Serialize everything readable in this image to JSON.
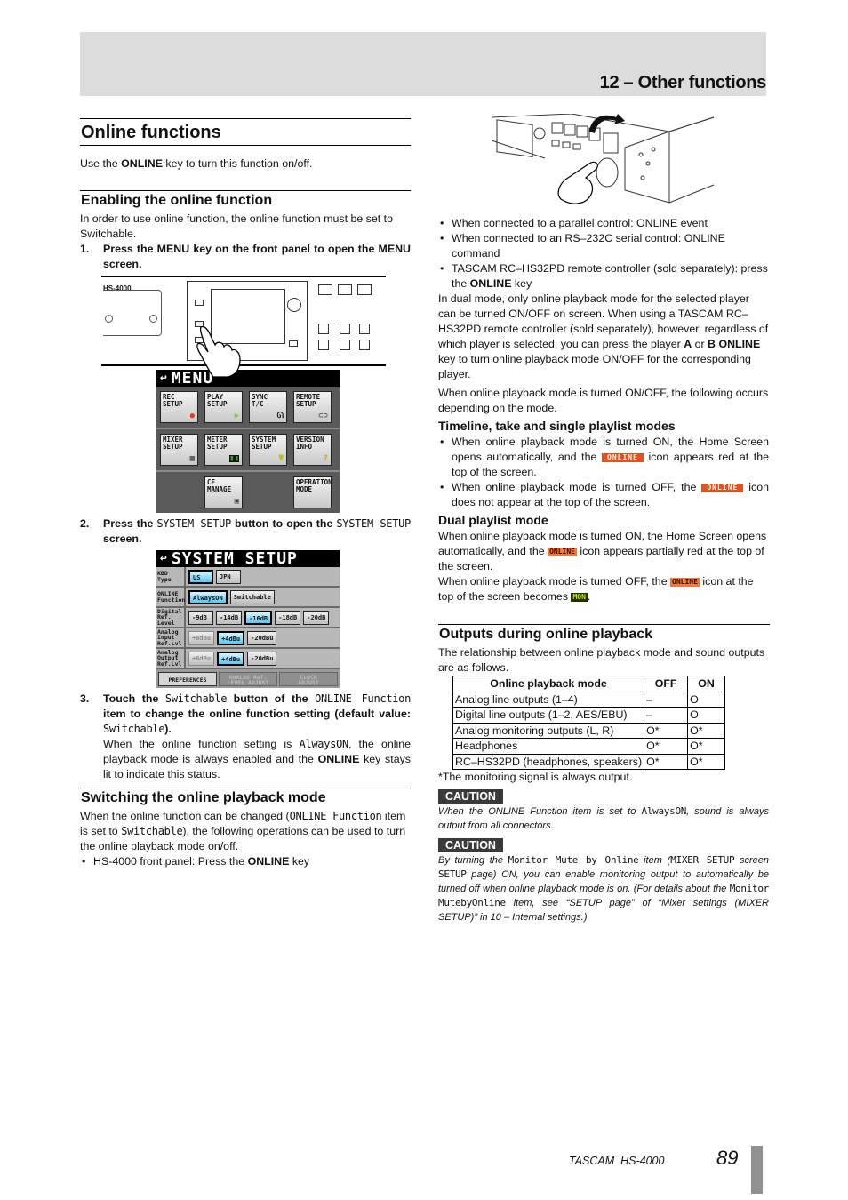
{
  "header": {
    "chapter": "12 – Other functions"
  },
  "left": {
    "title": "Online functions",
    "intro_pre": "Use the ",
    "intro_key": "ONLINE",
    "intro_post": " key to turn this function on/off.",
    "enabling": {
      "heading": "Enabling the online function",
      "body": "In order to use online function, the online function must be set to Switchable.",
      "step1_num": "1.",
      "step1": "Press the MENU key on the front panel to open the MENU screen.",
      "panel_model": "HS-4000",
      "menu_screen": {
        "title": "MENU",
        "rows": [
          [
            {
              "label": "REC\nSETUP",
              "icon": "record-dot-icon",
              "glyph": "●",
              "color": "#e2401a"
            },
            {
              "label": "PLAY\nSETUP",
              "icon": "play-arrow-icon",
              "glyph": "▶",
              "color": "#7ac943"
            },
            {
              "label": "SYNC\nT/C",
              "icon": "waveform-icon",
              "glyph": "⩍",
              "color": "#222222"
            },
            {
              "label": "REMOTE\nSETUP",
              "icon": "remote-connector-icon",
              "glyph": "⊂⊃",
              "color": "#555555"
            }
          ],
          [
            {
              "label": "MIXER\nSETUP",
              "icon": "mixer-grid-icon",
              "glyph": "▦",
              "color": "#444444"
            },
            {
              "label": "METER\nSETUP",
              "icon": "level-meter-icon",
              "glyph": "▮",
              "color": "#3aa020"
            },
            {
              "label": "SYSTEM\nSETUP",
              "icon": "wrench-icon",
              "glyph": "Ψ",
              "color": "#c8b400"
            },
            {
              "label": "VERSION\nINFO",
              "icon": "question-mark-icon",
              "glyph": "?",
              "color": "#c8a800"
            }
          ],
          [
            {
              "label": "CF\nMANAGE",
              "icon": "cf-card-icon",
              "glyph": "▣",
              "color": "#444444"
            },
            {
              "label": "OPERATION\nMODE",
              "icon": "",
              "glyph": "",
              "color": ""
            }
          ]
        ]
      },
      "step2_num": "2.",
      "step2_a": "Press the ",
      "step2_b": "SYSTEM SETUP",
      "step2_c": " button to open the ",
      "step2_d": "SYSTEM SETUP",
      "step2_e": " screen.",
      "system_screen": {
        "title": "SYSTEM SETUP",
        "rows": [
          {
            "label": "KBD\nType",
            "options": [
              "US",
              "JPN"
            ],
            "selected": 0,
            "disabled": []
          },
          {
            "label": "ONLINE\nFunction",
            "options": [
              "AlwaysON",
              "Switchable"
            ],
            "selected": 0,
            "disabled": []
          },
          {
            "label": "Digital\nRef.\nLevel",
            "options": [
              "-9dB",
              "-14dB",
              "-16dB",
              "-18dB",
              "-20dB"
            ],
            "selected": 2,
            "disabled": []
          },
          {
            "label": "Analog\nInput\nRef.Lvl",
            "options": [
              "+6dBu",
              "+4dBu",
              "-20dBu"
            ],
            "selected": 1,
            "disabled": [
              0
            ]
          },
          {
            "label": "Analog\nOutput\nRef.Lvl",
            "options": [
              "+6dBu",
              "+4dBu",
              "-20dBu"
            ],
            "selected": 1,
            "disabled": [
              0
            ]
          }
        ],
        "tabs": [
          {
            "label": "PREFERENCES",
            "active": true
          },
          {
            "label": "ANALOG Ref.\nLEVEL ADJUST",
            "active": false
          },
          {
            "label": "CLOCK\nADJUST",
            "active": false
          }
        ]
      },
      "step3_num": "3.",
      "step3_a": "Touch the ",
      "step3_b": "Switchable",
      "step3_c": " button of the ",
      "step3_d": "ONLINE Function",
      "step3_e": " item to change the online function setting (default value: ",
      "step3_f": "Switchable",
      "step3_g": ").",
      "step3_note_a": "When the online function setting is ",
      "step3_note_b": "AlwaysON",
      "step3_note_c": ", the online playback mode is always enabled and the ",
      "step3_note_d": "ONLINE",
      "step3_note_e": " key stays lit to indicate this status."
    },
    "switching": {
      "heading": "Switching the online playback mode",
      "body_a": "When the online function can be changed (",
      "body_b": "ONLINE Function",
      "body_c": " item is set to ",
      "body_d": "Switchable",
      "body_e": "), the following operations can be used to turn the online playback mode on/off.",
      "bullet1_a": "HS-4000 front panel: Press the ",
      "bullet1_b": "ONLINE",
      "bullet1_c": " key"
    }
  },
  "right": {
    "bullets": [
      "When connected to a parallel control: ONLINE event",
      "When connected to an RS–232C serial control: ONLINE command"
    ],
    "bullet3_a": "TASCAM RC–HS32PD remote controller (sold separately): press the ",
    "bullet3_b": "ONLINE",
    "bullet3_c": " key",
    "dual_a": "In dual mode, only online playback mode for the selected player can be turned ON/OFF on screen. When using a TASCAM RC–HS32PD remote controller (sold separately), however, regardless of which player is selected, you can press the player ",
    "dual_b": "A",
    "dual_c": " or ",
    "dual_d": "B ONLINE",
    "dual_e": " key to turn online playback mode ON/OFF for the corresponding player.",
    "onoff": "When online playback mode is turned ON/OFF, the following occurs depending on the mode.",
    "timeline": {
      "heading": "Timeline, take and single playlist modes",
      "b1_a": "When online playback mode is turned ON, the Home Screen opens automatically, and the ",
      "b1_b": " icon appears red at the top of the screen.",
      "b2_a": "When online playback mode is turned OFF, the ",
      "b2_b": " icon does not appear at the top of the screen."
    },
    "dual": {
      "heading": "Dual playlist mode",
      "p1_a": "When online playback mode is turned ON, the Home Screen opens automatically, and the ",
      "p1_b": " icon appears partially red at the top of the screen.",
      "p2_a": "When online playback mode is turned OFF, the ",
      "p2_b": " icon at the top of the screen becomes ",
      "p2_c": "."
    },
    "icons": {
      "online": "ONLINE",
      "online_small": "ONLINE",
      "mon": "MON"
    },
    "outputs": {
      "heading": "Outputs during online playback",
      "body": "The relationship between online playback mode and sound outputs are as follows.",
      "table": {
        "headers": [
          "Online playback mode",
          "OFF",
          "ON"
        ],
        "rows": [
          [
            "Analog line outputs (1–4)",
            "–",
            "O"
          ],
          [
            "Digital line outputs (1–2, AES/EBU)",
            "–",
            "O"
          ],
          [
            "Analog monitoring outputs (L, R)",
            "O*",
            "O*"
          ],
          [
            "Headphones",
            "O*",
            "O*"
          ],
          [
            "RC–HS32PD (headphones, speakers)",
            "O*",
            "O*"
          ]
        ]
      },
      "footnote": "*The monitoring signal is always output."
    },
    "caution1": {
      "label": "CAUTION",
      "a": "When the ONLINE Function item is set to ",
      "b": "AlwaysON",
      "c": ", sound is always output from all connectors."
    },
    "caution2": {
      "label": "CAUTION",
      "a": "By turning the ",
      "b": "Monitor Mute by Online",
      "c": " item (",
      "d": "MIXER SETUP",
      "e": " screen ",
      "f": "SETUP",
      "g": " page) ON, you can enable monitoring output to automatically be turned off when online playback mode is on. (For details about the ",
      "h": "Monitor MutebyOnline",
      "i": " item, see “SETUP page” of “Mixer settings (MIXER SETUP)” in 10 – Internal settings.)"
    }
  },
  "footer": {
    "brand": "TASCAM  HS-4000",
    "page": "89"
  }
}
